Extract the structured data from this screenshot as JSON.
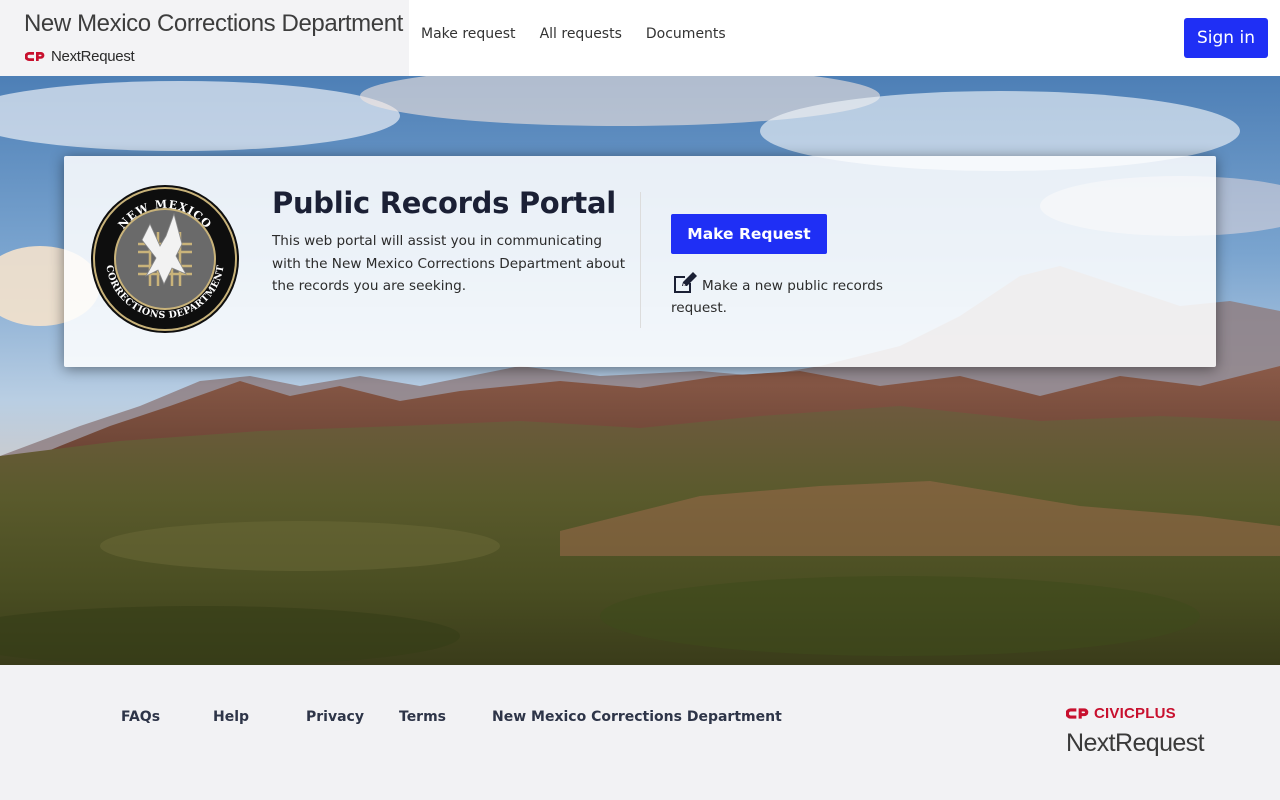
{
  "header": {
    "agency_name": "New Mexico Corrections Department",
    "brand_logo_text": "NextRequest",
    "nav": [
      {
        "label": "Make request"
      },
      {
        "label": "All requests"
      },
      {
        "label": "Documents"
      }
    ],
    "sign_in_label": "Sign in"
  },
  "hero": {
    "seal_text_top": "NEW MEXICO",
    "seal_text_bottom": "CORRECTIONS DEPARTMENT",
    "title": "Public Records Portal",
    "description": "This web portal will assist you in communicating with the New Mexico Corrections Department about the records you are seeking.",
    "make_request_label": "Make Request",
    "make_request_note": "Make a new public records request."
  },
  "footer": {
    "links": [
      {
        "label": "FAQs"
      },
      {
        "label": "Help"
      },
      {
        "label": "Privacy"
      },
      {
        "label": "Terms"
      },
      {
        "label": "New Mexico Corrections Department"
      }
    ],
    "civicplus_label": "CIVICPLUS",
    "nextrequest_label": "NextRequest"
  },
  "colors": {
    "primary": "#1f2ff5",
    "civicplus_red": "#c8102e"
  },
  "icons": {
    "brand": "civicplus-logo-icon",
    "edit": "edit-icon"
  }
}
